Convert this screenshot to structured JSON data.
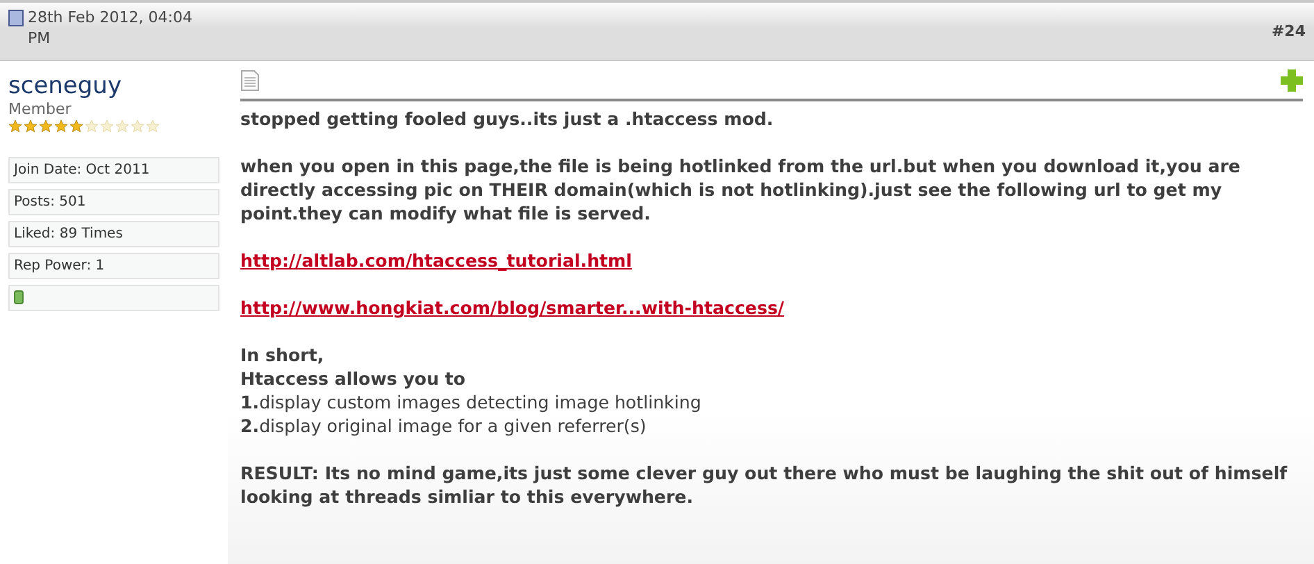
{
  "post_header": {
    "date": "28th Feb 2012, 04:04 PM",
    "post_number": "#24"
  },
  "user": {
    "name": "sceneguy",
    "title": "Member",
    "stars": 5,
    "stats": [
      "Join Date: Oct 2011",
      "Posts: 501",
      "Liked: 89 Times",
      "Rep Power: 1"
    ]
  },
  "message": [
    {
      "kind": "bold",
      "text": "stopped getting fooled guys..its just a .htaccess mod."
    },
    {
      "kind": "bold",
      "text": "when you open in this page,the file is being hotlinked from the url.but when you download it,you are directly accessing pic on THEIR domain(which is not hotlinking).just see the following url to get my point.they can modify what file is served."
    },
    {
      "kind": "link",
      "text": "http://altlab.com/htaccess_tutorial.html"
    },
    {
      "kind": "link",
      "text": "http://www.hongkiat.com/blog/smarter...with-htaccess/"
    },
    {
      "kind": "lines",
      "lines": [
        "**In short,**",
        "**Htaccess allows you to**",
        "**1.**display custom images detecting image hotlinking",
        "**2.**display original image for a given referrer(s)"
      ]
    },
    {
      "kind": "bold",
      "text": "RESULT: Its no mind game,its just some clever guy out there who must be laughing the shit out of himself looking at threads simliar to this everywhere."
    }
  ]
}
